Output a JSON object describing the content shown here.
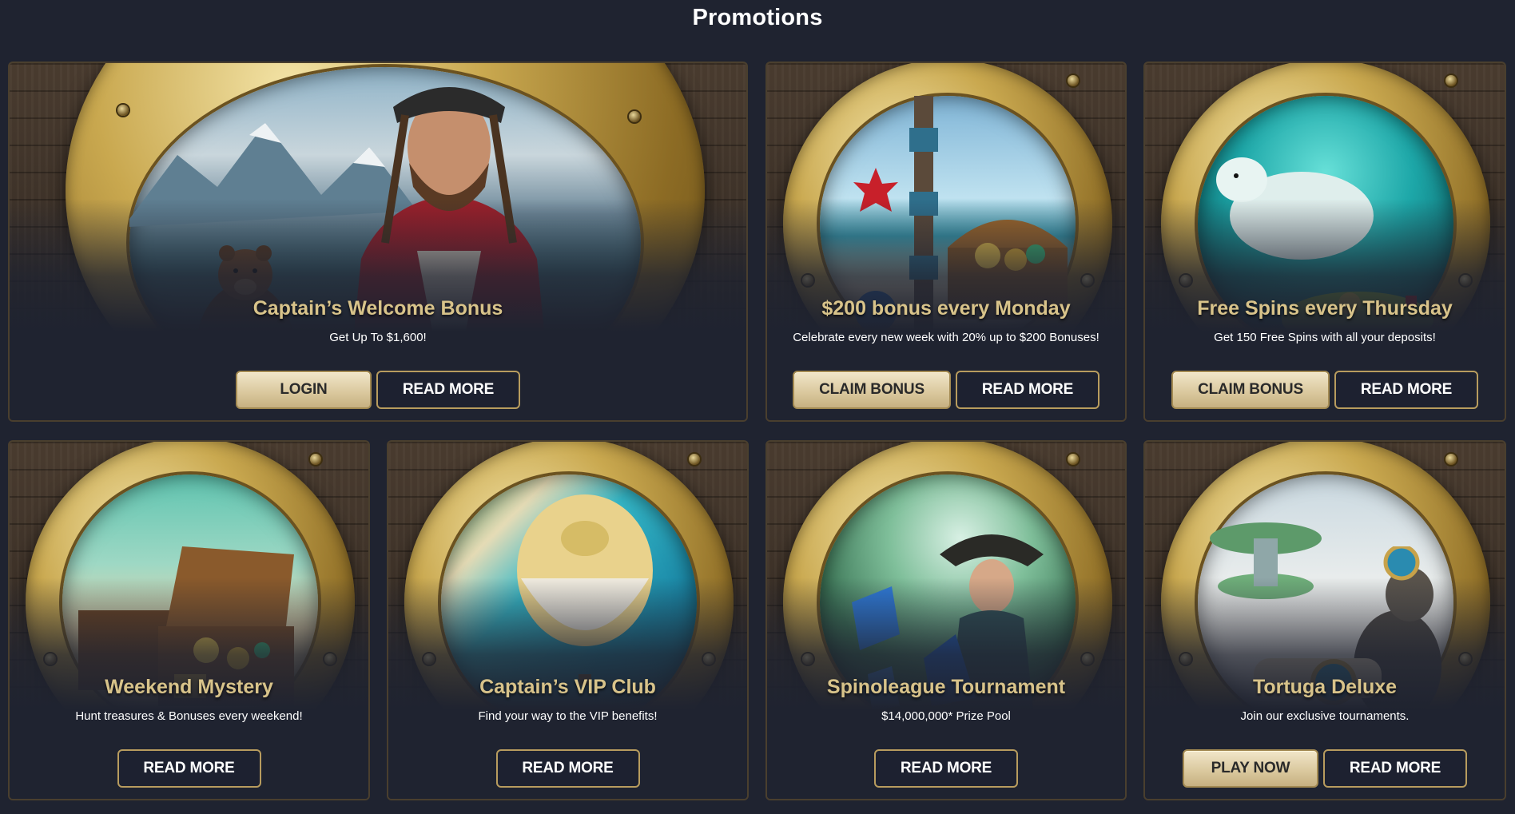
{
  "page": {
    "title": "Promotions"
  },
  "colors": {
    "background": "#1f2330",
    "title_gold": "#d8c38a",
    "button_gold": "#e6d7b1",
    "button_border": "#b89c5e"
  },
  "promotions": [
    {
      "title": "Captain’s Welcome Bonus",
      "description": "Get Up To $1,600!",
      "primary_label": "LOGIN",
      "secondary_label": "READ MORE",
      "art": "pirate-captain-with-bear"
    },
    {
      "title": "$200 bonus every Monday",
      "description": "Celebrate every new week with 20% up to $200 Bonuses!",
      "primary_label": "CLAIM BONUS",
      "secondary_label": "READ MORE",
      "art": "totem-and-treasure-chest"
    },
    {
      "title": "Free Spins every Thursday",
      "description": "Get 150 Free Spins with all your deposits!",
      "primary_label": "CLAIM BONUS",
      "secondary_label": "READ MORE",
      "art": "polar-bear-underwater"
    },
    {
      "title": "Weekend Mystery",
      "description": "Hunt treasures & Bonuses every weekend!",
      "secondary_label": "READ MORE",
      "art": "treasure-chests"
    },
    {
      "title": "Captain’s VIP Club",
      "description": "Find your way to the VIP benefits!",
      "secondary_label": "READ MORE",
      "art": "hot-air-balloon"
    },
    {
      "title": "Spinoleague Tournament",
      "description": "$14,000,000* Prize Pool",
      "secondary_label": "READ MORE",
      "art": "pirate-woman-crystals"
    },
    {
      "title": "Tortuga Deluxe",
      "description": "Join our exclusive tournaments.",
      "primary_label": "PLAY NOW",
      "secondary_label": "READ MORE",
      "art": "seal-with-compass"
    }
  ]
}
